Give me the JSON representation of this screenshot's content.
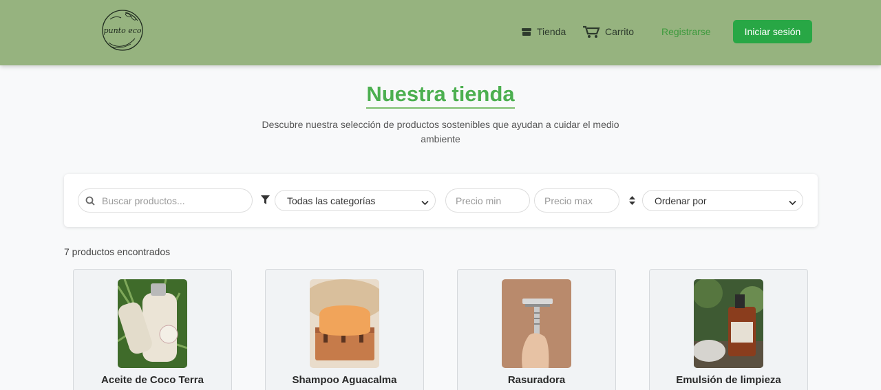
{
  "header": {
    "logo_text": "punto eco",
    "nav": {
      "tienda": "Tienda",
      "carrito": "Carrito",
      "registrarse": "Registrarse",
      "login": "Iniciar sesión"
    }
  },
  "hero": {
    "title": "Nuestra tienda",
    "subtitle": "Descubre nuestra selección de productos sostenibles que ayudan a cuidar el medio ambiente"
  },
  "filters": {
    "search_placeholder": "Buscar productos...",
    "category_selected": "Todas las categorías",
    "price_min_placeholder": "Precio min",
    "price_max_placeholder": "Precio max",
    "sort_selected": "Ordenar por"
  },
  "results": {
    "count_label": "7 productos encontrados"
  },
  "products": [
    {
      "name": "Aceite de Coco Terra"
    },
    {
      "name": "Shampoo Aguacalma"
    },
    {
      "name": "Rasuradora"
    },
    {
      "name": "Emulsión de limpieza"
    }
  ],
  "colors": {
    "header_bg": "#96b37f",
    "accent_green": "#28a745",
    "title_green": "#4caf50"
  }
}
